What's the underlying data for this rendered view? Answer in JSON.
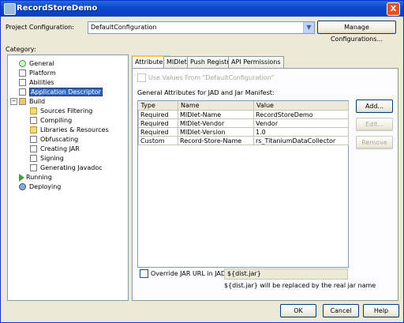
{
  "window": {
    "title": "RecordStoreDemo",
    "close_label": "X"
  },
  "config": {
    "label": "Project Configuration:",
    "value": "DefaultConfiguration",
    "manage_label": "Manage Configurations..."
  },
  "category_label": "Category:",
  "tree": {
    "items": [
      {
        "label": "General"
      },
      {
        "label": "Platform"
      },
      {
        "label": "Abilities"
      },
      {
        "label": "Application Descriptor"
      },
      {
        "label": "Build"
      },
      {
        "label": "Sources Filtering"
      },
      {
        "label": "Compiling"
      },
      {
        "label": "Libraries & Resources"
      },
      {
        "label": "Obfuscating"
      },
      {
        "label": "Creating JAR"
      },
      {
        "label": "Signing"
      },
      {
        "label": "Generating Javadoc"
      },
      {
        "label": "Running"
      },
      {
        "label": "Deploying"
      }
    ]
  },
  "tabs": [
    "Attributes",
    "MIDlets",
    "Push Registry",
    "API Permissions"
  ],
  "attributes": {
    "use_values_label": "Use Values From \"DefaultConfiguration\"",
    "section_label": "General Attributes for JAD and Jar Manifest:",
    "headers": [
      "Type",
      "Name",
      "Value"
    ],
    "rows": [
      [
        "Required",
        "MIDlet-Name",
        "RecordStoreDemo"
      ],
      [
        "Required",
        "MIDlet-Vendor",
        "Vendor"
      ],
      [
        "Required",
        "MIDlet-Version",
        "1.0"
      ],
      [
        "Custom",
        "Record-Store-Name",
        "rs_TitaniumDataCollector"
      ]
    ],
    "add_label": "Add...",
    "edit_label": "Edit...",
    "remove_label": "Remove",
    "override_label": "Override JAR URL in JAD:",
    "override_value": "${dist.jar}",
    "override_note": "${dist.jar} will be replaced by the real jar name"
  },
  "footer": {
    "ok": "OK",
    "cancel": "Cancel",
    "help": "Help"
  }
}
